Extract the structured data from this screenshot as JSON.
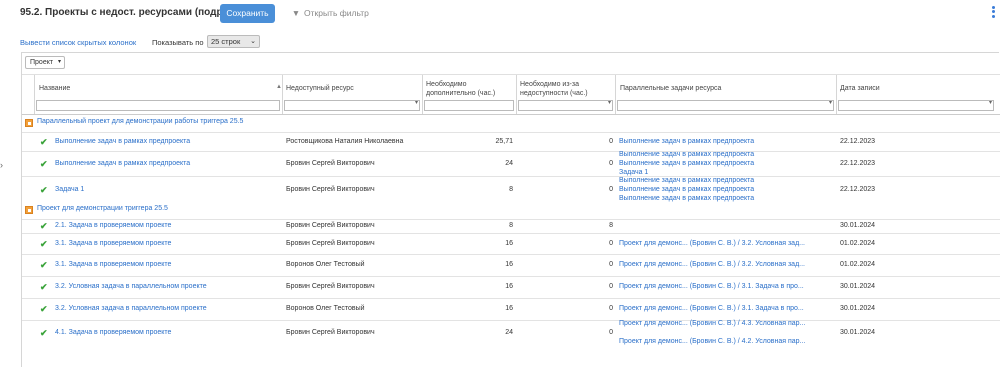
{
  "header": {
    "title": "95.2. Проекты с недост. ресурсами (подробный)",
    "save_label": "Сохранить",
    "filter_label": "Открыть фильтр"
  },
  "toolbar": {
    "hidden_columns_link": "Вывести список скрытых колонок",
    "show_label": "Показывать по",
    "page_size": "25 строк"
  },
  "grid": {
    "group_by": "Проект",
    "columns": [
      "Название",
      "Недоступный ресурс",
      "Необходимо дополнительно (час.)",
      "Необходимо из-за недоступности (час.)",
      "Параллельные задачи ресурса",
      "Дата записи"
    ],
    "groups": [
      {
        "title": "Параллельный проект для демонстрации работы триггера 25.5",
        "rows": [
          {
            "name": "Выполнение задач в рамках предпроекта",
            "resource": "Ростовщикова Наталия Николаевна",
            "extra": "25,71",
            "unavail": "0",
            "parallel": [
              "Выполнение задач в рамках предпроекта"
            ],
            "date": "22.12.2023"
          },
          {
            "name": "Выполнение задач в рамках предпроекта",
            "resource": "Бровин Сергей Викторович",
            "extra": "24",
            "unavail": "0",
            "parallel": [
              "Выполнение задач в рамках предпроекта",
              "Выполнение задач в рамках предпроекта",
              "Задача 1"
            ],
            "date": "22.12.2023"
          },
          {
            "name": "Задача 1",
            "resource": "Бровин Сергей Викторович",
            "extra": "8",
            "unavail": "0",
            "parallel": [
              "Выполнение задач в рамках предпроекта",
              "Выполнение задач в рамках предпроекта",
              "Выполнение задач в рамках предпроекта"
            ],
            "date": "22.12.2023"
          }
        ]
      },
      {
        "title": "Проект для демонстрации триггера 25.5",
        "rows": [
          {
            "name": "2.1. Задача в проверяемом проекте",
            "resource": "Бровин Сергей Викторович",
            "extra": "8",
            "unavail": "8",
            "parallel": [],
            "date": "30.01.2024"
          },
          {
            "name": "3.1. Задача в проверяемом проекте",
            "resource": "Бровин Сергей Викторович",
            "extra": "16",
            "unavail": "0",
            "parallel": [
              "Проект для демонс... (Бровин С. В.) / 3.2. Условная зад..."
            ],
            "date": "01.02.2024"
          },
          {
            "name": "3.1. Задача в проверяемом проекте",
            "resource": "Воронов Олег Тестовый",
            "extra": "16",
            "unavail": "0",
            "parallel": [
              "Проект для демонс... (Бровин С. В.) / 3.2. Условная зад..."
            ],
            "date": "01.02.2024"
          },
          {
            "name": "3.2. Условная задача в параллельном проекте",
            "resource": "Бровин Сергей Викторович",
            "extra": "16",
            "unavail": "0",
            "parallel": [
              "Проект для демонс... (Бровин С. В.) / 3.1. Задача в про..."
            ],
            "date": "30.01.2024"
          },
          {
            "name": "3.2. Условная задача в параллельном проекте",
            "resource": "Воронов Олег Тестовый",
            "extra": "16",
            "unavail": "0",
            "parallel": [
              "Проект для демонс... (Бровин С. В.) / 3.1. Задача в про..."
            ],
            "date": "30.01.2024"
          },
          {
            "name": "4.1. Задача в проверяемом проекте",
            "resource": "Бровин Сергей Викторович",
            "extra": "24",
            "unavail": "0",
            "parallel": [
              "Проект для демонс... (Бровин С. В.) / 4.3. Условная пар...",
              "Проект для демонс... (Бровин С. В.) / 4.2. Условная пар..."
            ],
            "date": "30.01.2024"
          }
        ]
      }
    ]
  },
  "colors": {
    "accent": "#4a8fd8",
    "link": "#2a6fc9",
    "check": "#3aa33a",
    "group_icon": "#f2a03a"
  }
}
